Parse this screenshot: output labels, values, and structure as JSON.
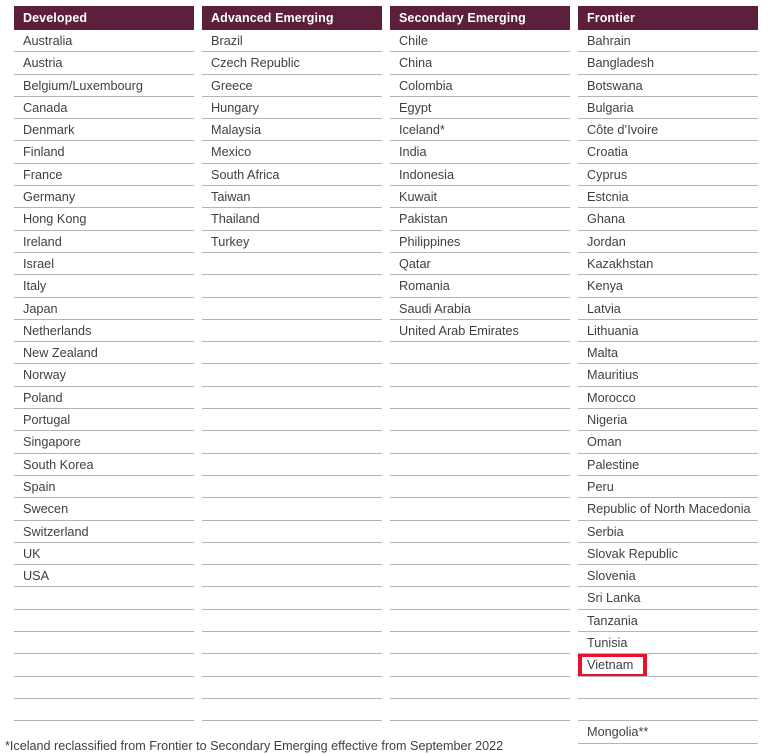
{
  "table": {
    "columns": [
      {
        "header": "Developed",
        "items": [
          "Australia",
          "Austria",
          "Belgium/Luxembourg",
          "Canada",
          "Denmark",
          "Finland",
          "France",
          "Germany",
          "Hong Kong",
          "Ireland",
          "Israel",
          "Italy",
          "Japan",
          "Netherlands",
          "New Zealand",
          "Norway",
          "Poland",
          "Portugal",
          "Singapore",
          "South Korea",
          "Spain",
          "Swecen",
          "Switzerland",
          "UK",
          "USA"
        ],
        "empty_rows": 6
      },
      {
        "header": "Advanced Emerging",
        "items": [
          "Brazil",
          "Czech Republic",
          "Greece",
          "Hungary",
          "Malaysia",
          "Mexico",
          "South Africa",
          "Taiwan",
          "Thailand",
          "Turkey"
        ],
        "empty_rows": 21
      },
      {
        "header": "Secondary Emerging",
        "items": [
          "Chile",
          "China",
          "Colombia",
          "Egypt",
          "Iceland*",
          "India",
          "Indonesia",
          "Kuwait",
          "Pakistan",
          "Philippines",
          "Qatar",
          "Romania",
          "Saudi Arabia",
          "United Arab Emirates"
        ],
        "empty_rows": 17
      },
      {
        "header": "Frontier",
        "items": [
          "Bahrain",
          "Bangladesh",
          "Botswana",
          "Bulgaria",
          "Côte d’Ivoire",
          "Croatia",
          "Cyprus",
          "Estcnia",
          "Ghana",
          "Jordan",
          "Kazakhstan",
          "Kenya",
          "Latvia",
          "Lithuania",
          "Malta",
          "Mauritius",
          "Morocco",
          "Nigeria",
          "Oman",
          "Palestine",
          "Peru",
          "Republic of North Macedonia",
          "Serbia",
          "Slovak Republic",
          "Slovenia",
          "Sri Lanka",
          "Tanzania",
          "Tunisia",
          "Vietnam"
        ],
        "highlighted_item": "Vietnam",
        "trailing_empty_rows": 2,
        "final_item": "Mongolia**"
      }
    ]
  },
  "footnote": "*Iceland reclassified from Frontier to Secondary Emerging effective from September 2022",
  "colors": {
    "header_background": "#5c1f3c",
    "header_text": "#ffffff",
    "row_border": "#b4b4b4",
    "body_text": "#3f3f46",
    "highlight_border": "#e8112d"
  }
}
